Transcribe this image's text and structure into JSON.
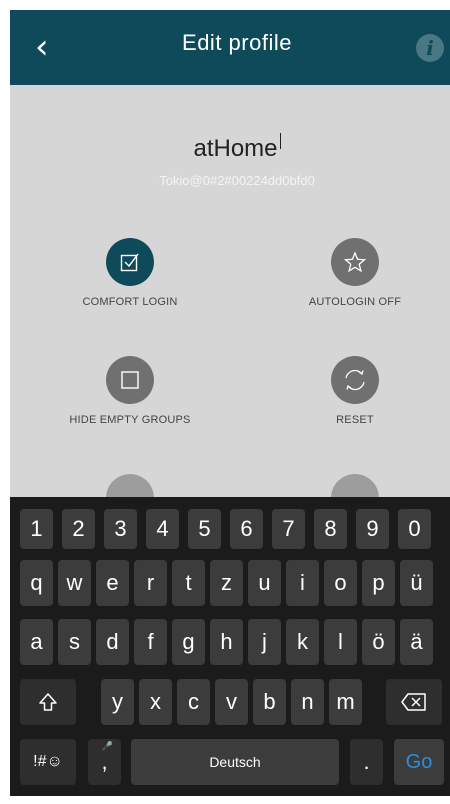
{
  "header": {
    "title": "Edit profile",
    "back_glyph": "‹",
    "info_glyph": "i"
  },
  "profile": {
    "name": "atHome",
    "id": "Tokio@0#2#00224dd0bfd0"
  },
  "actions": [
    {
      "label": "COMFORT LOGIN",
      "icon": "checkbox-checked-icon",
      "active": true
    },
    {
      "label": "AUTOLOGIN OFF",
      "icon": "star-icon",
      "active": false
    },
    {
      "label": "HIDE EMPTY GROUPS",
      "icon": "square-icon",
      "active": false
    },
    {
      "label": "RESET",
      "icon": "refresh-icon",
      "active": false
    }
  ],
  "keyboard": {
    "numbers": [
      "1",
      "2",
      "3",
      "4",
      "5",
      "6",
      "7",
      "8",
      "9",
      "0"
    ],
    "row1": [
      "q",
      "w",
      "e",
      "r",
      "t",
      "z",
      "u",
      "i",
      "o",
      "p",
      "ü"
    ],
    "row2": [
      "a",
      "s",
      "d",
      "f",
      "g",
      "h",
      "j",
      "k",
      "l",
      "ö",
      "ä"
    ],
    "row3": [
      "y",
      "x",
      "c",
      "v",
      "b",
      "n",
      "m"
    ],
    "symbols_label": "!#☺",
    "comma_label": ",",
    "space_label": "Deutsch",
    "period_label": ".",
    "go_label": "Go",
    "shift_icon": "shift-icon",
    "backspace_icon": "backspace-icon",
    "mic_icon": "microphone-icon"
  },
  "colors": {
    "header": "#0f4a5a",
    "accent_active": "#0f4a5a",
    "inactive": "#707070",
    "go": "#2f8cdc"
  }
}
